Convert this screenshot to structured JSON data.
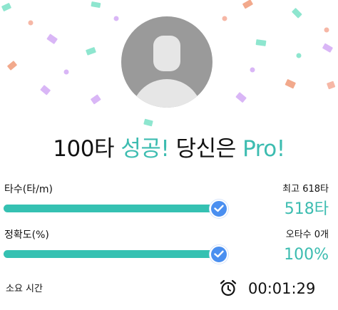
{
  "headline": {
    "part1": "100타 ",
    "part2": "성공!",
    "part3": " 당신은 ",
    "part4": "Pro!"
  },
  "speed": {
    "label": "타수(타/m)",
    "best": "최고 618타",
    "value": "518타",
    "progress": 1.0
  },
  "accuracy": {
    "label": "정확도(%)",
    "typos": "오타수 0개",
    "value": "100%",
    "progress": 1.0
  },
  "elapsed": {
    "label": "소요 시간",
    "icon": "alarm-clock-icon",
    "value": "00:01:29"
  },
  "avatar": {
    "icon": "user-avatar-icon"
  },
  "colors": {
    "accent": "#3cbcb0",
    "bar": "#35c1b2",
    "check": "#4a8ff0",
    "confetti": [
      "#8ee6cf",
      "#f6b7a6",
      "#d9b6f6",
      "#f2a98c"
    ]
  }
}
